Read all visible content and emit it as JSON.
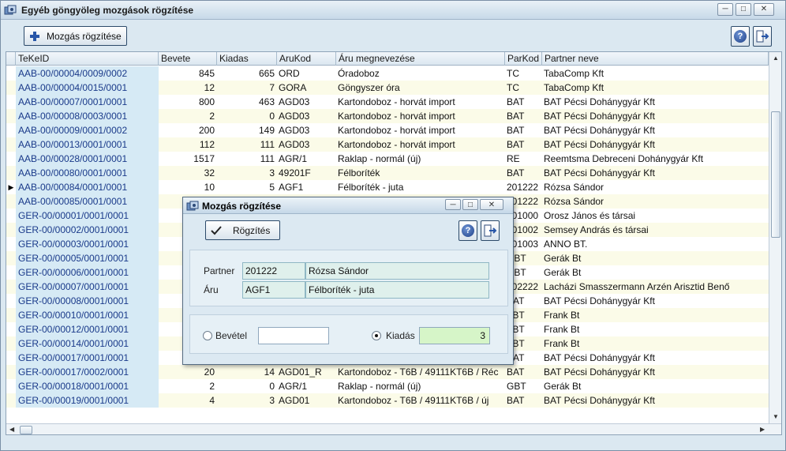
{
  "window": {
    "title": "Egyéb göngyöleg mozgások rögzítése",
    "controls": [
      "minimize",
      "maximize",
      "close"
    ]
  },
  "toolbar": {
    "add_label": "Mozgás rögzítése",
    "help_icon": "help-icon",
    "exit_icon": "exit-icon"
  },
  "grid": {
    "columns": [
      "TeKeID",
      "Bevete",
      "Kiadas",
      "AruKod",
      "Áru megnevezése",
      "ParKod",
      "Partner neve"
    ],
    "current_row": 8,
    "rows": [
      [
        "AAB-00/00004/0009/0002",
        "845",
        "665",
        "ORD",
        "Óradoboz",
        "TC",
        "TabaComp Kft"
      ],
      [
        "AAB-00/00004/0015/0001",
        "12",
        "7",
        "GORA",
        "Göngyszer óra",
        "TC",
        "TabaComp Kft"
      ],
      [
        "AAB-00/00007/0001/0001",
        "800",
        "463",
        "AGD03",
        "Kartondoboz - horvát import",
        "BAT",
        "BAT Pécsi Dohánygyár Kft"
      ],
      [
        "AAB-00/00008/0003/0001",
        "2",
        "0",
        "AGD03",
        "Kartondoboz - horvát import",
        "BAT",
        "BAT Pécsi Dohánygyár Kft"
      ],
      [
        "AAB-00/00009/0001/0002",
        "200",
        "149",
        "AGD03",
        "Kartondoboz - horvát import",
        "BAT",
        "BAT Pécsi Dohánygyár Kft"
      ],
      [
        "AAB-00/00013/0001/0001",
        "112",
        "111",
        "AGD03",
        "Kartondoboz - horvát import",
        "BAT",
        "BAT Pécsi Dohánygyár Kft"
      ],
      [
        "AAB-00/00028/0001/0001",
        "1517",
        "111",
        "AGR/1",
        "Raklap - normál (új)",
        "RE",
        "Reemtsma Debreceni Dohánygyár Kft"
      ],
      [
        "AAB-00/00080/0001/0001",
        "32",
        "3",
        "49201F",
        "Félboríték",
        "BAT",
        "BAT Pécsi Dohánygyár Kft"
      ],
      [
        "AAB-00/00084/0001/0001",
        "10",
        "5",
        "AGF1",
        "Félboríték - juta",
        "201222",
        "Rózsa Sándor"
      ],
      [
        "AAB-00/00085/0001/0001",
        "",
        "",
        "",
        "",
        "201222",
        "Rózsa Sándor"
      ],
      [
        "GER-00/00001/0001/0001",
        "",
        "",
        "",
        "",
        "201000",
        "Orosz János és társai"
      ],
      [
        "GER-00/00002/0001/0001",
        "",
        "",
        "",
        "",
        "201002",
        "Semsey András és társai"
      ],
      [
        "GER-00/00003/0001/0001",
        "",
        "",
        "",
        "",
        "201003",
        "ANNO BT."
      ],
      [
        "GER-00/00005/0001/0001",
        "",
        "",
        "",
        "",
        "GBT",
        "Gerák Bt"
      ],
      [
        "GER-00/00006/0001/0001",
        "",
        "",
        "",
        "",
        "GBT",
        "Gerák Bt"
      ],
      [
        "GER-00/00007/0001/0001",
        "",
        "",
        "",
        "",
        "202222",
        "Lacházi Smasszermann Arzén Arisztid Benő"
      ],
      [
        "GER-00/00008/0001/0001",
        "",
        "",
        "",
        "",
        "BAT",
        "BAT Pécsi Dohánygyár Kft"
      ],
      [
        "GER-00/00010/0001/0001",
        "",
        "",
        "",
        "",
        "FBT",
        "Frank Bt"
      ],
      [
        "GER-00/00012/0001/0001",
        "",
        "",
        "",
        "",
        "FBT",
        "Frank Bt"
      ],
      [
        "GER-00/00014/0001/0001",
        "",
        "",
        "",
        "",
        "FBT",
        "Frank Bt"
      ],
      [
        "GER-00/00017/0001/0001",
        "",
        "",
        "",
        "",
        "BAT",
        "BAT Pécsi Dohánygyár Kft"
      ],
      [
        "GER-00/00017/0002/0001",
        "20",
        "14",
        "AGD01_R",
        "Kartondoboz - T6B / 49111KT6B / Réc",
        "BAT",
        "BAT Pécsi Dohánygyár Kft"
      ],
      [
        "GER-00/00018/0001/0001",
        "2",
        "0",
        "AGR/1",
        "Raklap - normál (új)",
        "GBT",
        "Gerák Bt"
      ],
      [
        "GER-00/00019/0001/0001",
        "4",
        "3",
        "AGD01",
        "Kartondoboz - T6B / 49111KT6B / új",
        "BAT",
        "BAT Pécsi Dohánygyár Kft"
      ]
    ]
  },
  "dialog": {
    "title": "Mozgás rögzítése",
    "save_label": "Rögzítés",
    "partner_label": "Partner",
    "partner_code": "201222",
    "partner_name": "Rózsa Sándor",
    "item_label": "Áru",
    "item_code": "AGF1",
    "item_name": "Félboríték - juta",
    "income_label": "Bevétel",
    "income_value": "",
    "expense_label": "Kiadás",
    "expense_value": "3",
    "selected_option": "Kiadás"
  },
  "colors": {
    "id_column_bg": "#d6eaf5",
    "row_alt_bg": "#fbfbe8",
    "dialog_field_bg": "#dff0ec",
    "expense_field_bg": "#d6f5c8",
    "accent": "#1d3f87"
  }
}
